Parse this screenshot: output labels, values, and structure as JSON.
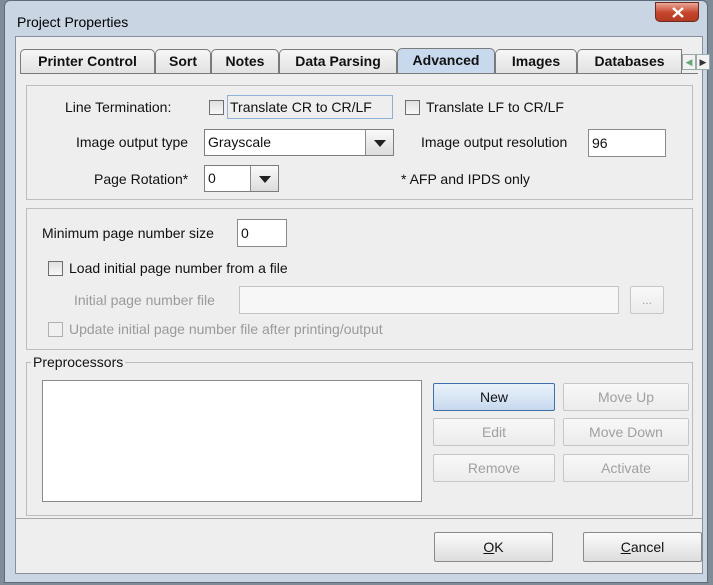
{
  "window": {
    "title": "Project Properties"
  },
  "tabs": [
    {
      "label": "Printer Control"
    },
    {
      "label": "Sort"
    },
    {
      "label": "Notes"
    },
    {
      "label": "Data Parsing"
    },
    {
      "label": "Advanced"
    },
    {
      "label": "Images"
    },
    {
      "label": "Databases"
    }
  ],
  "active_tab": "Advanced",
  "advanced": {
    "line_termination_label": "Line Termination:",
    "cr_to_crlf_label": "Translate CR to CR/LF",
    "lf_to_crlf_label": "Translate LF to CR/LF",
    "image_output_type_label": "Image output type",
    "image_output_type_value": "Grayscale",
    "image_output_resolution_label": "Image output resolution",
    "image_output_resolution_value": "96",
    "page_rotation_label": "Page Rotation*",
    "page_rotation_value": "0",
    "afp_note": "* AFP and IPDS only"
  },
  "page_number": {
    "min_size_label": "Minimum page number size",
    "min_size_value": "0",
    "load_from_file_label": "Load initial page number from a file",
    "initial_file_label": "Initial page number file",
    "initial_file_value": "",
    "browse_label": "...",
    "update_file_label": "Update initial page number file after printing/output"
  },
  "preprocessors": {
    "title": "Preprocessors",
    "new_label": "New",
    "move_up_label": "Move Up",
    "edit_label": "Edit",
    "move_down_label": "Move Down",
    "remove_label": "Remove",
    "activate_label": "Activate"
  },
  "footer": {
    "ok_mnemonic": "O",
    "ok_rest": "K",
    "cancel_mnemonic": "C",
    "cancel_rest": "ancel"
  },
  "icons": {
    "close": "close-icon",
    "tab_scroll_left": "chevron-left-icon",
    "tab_scroll_right": "chevron-right-icon",
    "dropdown": "chevron-down-icon"
  }
}
